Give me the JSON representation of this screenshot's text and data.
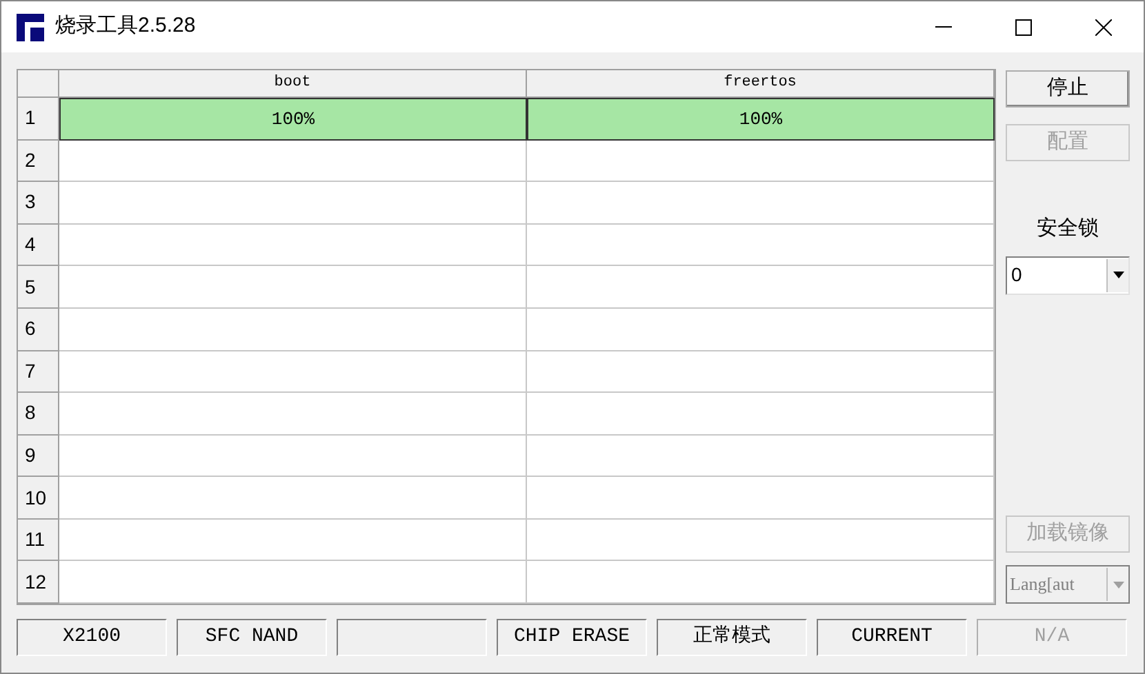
{
  "window": {
    "title": "烧录工具2.5.28"
  },
  "table": {
    "columns": [
      "boot",
      "freertos"
    ],
    "rows": [
      {
        "number": "1",
        "cells": [
          {
            "text": "100%",
            "done": true
          },
          {
            "text": "100%",
            "done": true
          }
        ]
      },
      {
        "number": "2"
      },
      {
        "number": "3"
      },
      {
        "number": "4"
      },
      {
        "number": "5"
      },
      {
        "number": "6"
      },
      {
        "number": "7"
      },
      {
        "number": "8"
      },
      {
        "number": "9"
      },
      {
        "number": "10"
      },
      {
        "number": "11"
      },
      {
        "number": "12"
      }
    ]
  },
  "side": {
    "buttons": [
      {
        "label": "停止",
        "disabled": false
      },
      {
        "label": "配置",
        "disabled": true
      }
    ],
    "lock_label": "安全锁",
    "lock_value": "0",
    "load_button": {
      "label": "加载镜像",
      "disabled": true
    },
    "lang": {
      "value": "Lang[aut",
      "disabled": true
    }
  },
  "status_bar": [
    {
      "text": "X2100",
      "disabled": false
    },
    {
      "text": "SFC NAND",
      "disabled": false
    },
    {
      "disabled": false
    },
    {
      "text": "CHIP ERASE",
      "disabled": false
    },
    {
      "text": "正常模式",
      "disabled": false
    },
    {
      "text": "CURRENT",
      "disabled": false
    },
    {
      "text": "N/A",
      "disabled": true
    }
  ]
}
